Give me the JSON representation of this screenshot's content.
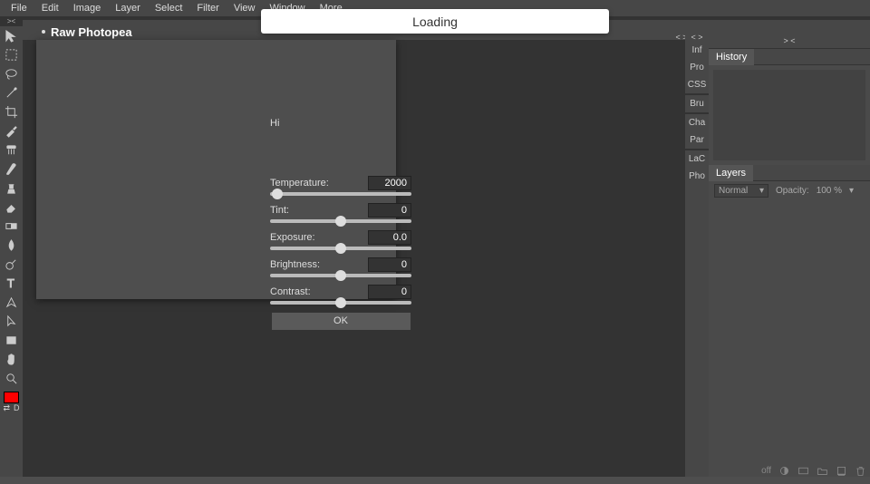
{
  "loading": {
    "text": "Loading"
  },
  "menubar": {
    "items": [
      "File",
      "Edit",
      "Image",
      "Layer",
      "Select",
      "Filter",
      "View",
      "Window",
      "More"
    ]
  },
  "window": {
    "title": "Raw Photopea"
  },
  "topzoom": "><",
  "dialog": {
    "greeting": "Hi",
    "rows": {
      "temperature": {
        "label": "Temperature:",
        "value": "2000",
        "pos": 5
      },
      "tint": {
        "label": "Tint:",
        "value": "0",
        "pos": 50
      },
      "exposure": {
        "label": "Exposure:",
        "value": "0.0",
        "pos": 50
      },
      "brightness": {
        "label": "Brightness:",
        "value": "0",
        "pos": 50
      },
      "contrast": {
        "label": "Contrast:",
        "value": "0",
        "pos": 50
      }
    },
    "ok": "OK"
  },
  "right": {
    "collapse": "< >",
    "collapse2": "> <",
    "tabs": [
      "Inf",
      "Pro",
      "CSS",
      "Bru",
      "Cha",
      "Par",
      "LaC",
      "Pho"
    ],
    "history_label": "History",
    "layers_label": "Layers",
    "blend_mode": "Normal",
    "opacity_label": "Opacity:",
    "opacity_value": "100 %"
  },
  "footer": {
    "off": "off"
  },
  "swatch": {
    "d": "D",
    "arrow": "⇄"
  }
}
